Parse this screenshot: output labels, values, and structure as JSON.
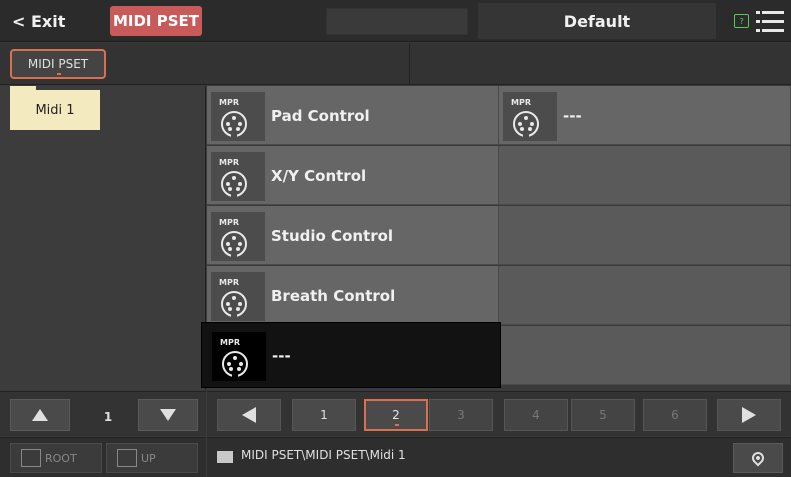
{
  "topbar": {
    "exit_label": "< Exit",
    "mode_label": "MIDI PSET",
    "set_name": "Default",
    "help_icon": "help-icon",
    "menu_icon": "hamburger-menu-icon",
    "mode_color": "#c85a5a"
  },
  "tabs": [
    {
      "label": "MIDI PSET",
      "selected": true
    }
  ],
  "folders": [
    {
      "label": "Midi 1",
      "selected": true
    }
  ],
  "grid": {
    "items": [
      {
        "badge": "MPR",
        "label": "Pad Control"
      },
      {
        "badge": "MPR",
        "label": "---"
      },
      {
        "badge": "MPR",
        "label": "X/Y Control"
      },
      {
        "badge": "MPR",
        "label": "Studio Control"
      },
      {
        "badge": "MPR",
        "label": "Breath Control"
      },
      {
        "badge": "MPR",
        "label": "---",
        "selected": true
      }
    ]
  },
  "left_nav": {
    "page": "1"
  },
  "pager": {
    "pages": [
      "1",
      "2",
      "3",
      "4",
      "5",
      "6"
    ],
    "current": "2"
  },
  "footer": {
    "root_label": "ROOT",
    "up_label": "UP",
    "path": "MIDI PSET\\MIDI PSET\\Midi 1"
  },
  "colors": {
    "accent": "#d97050",
    "folder": "#f3eac0"
  }
}
